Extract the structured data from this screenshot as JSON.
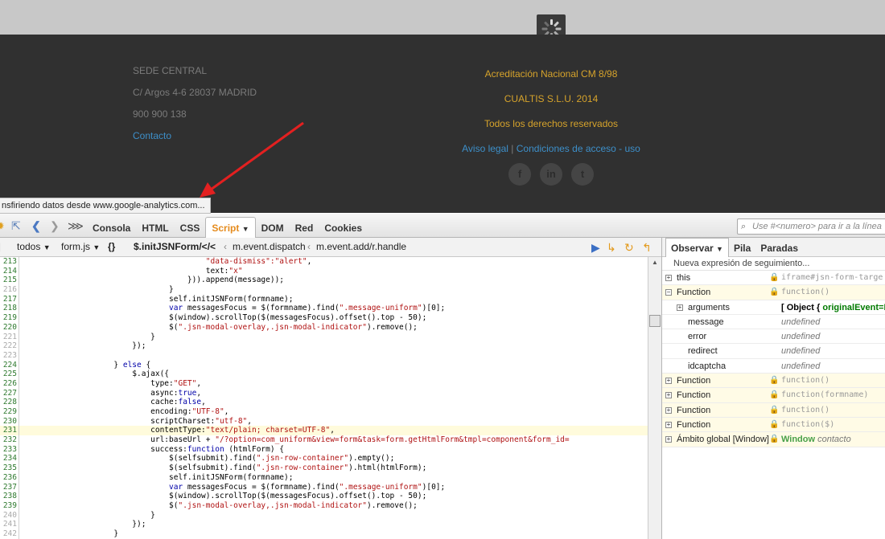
{
  "footer": {
    "left": [
      "SEDE CENTRAL",
      "C/ Argos 4-6 28037 MADRID",
      "900 900 138"
    ],
    "contact_link": "Contacto",
    "right": [
      "Acreditación Nacional CM 8/98",
      "CUALTIS S.L.U. 2014",
      "Todos los derechos reservados"
    ],
    "legal_link": "Aviso legal",
    "legal_sep": "|",
    "terms_link": "Condiciones de acceso - uso",
    "social_glyphs": [
      "f",
      "in",
      "t"
    ]
  },
  "status_text": "nsfiriendo datos desde www.google-analytics.com...",
  "firebug": {
    "tabs": [
      "Consola",
      "HTML",
      "CSS",
      "Script",
      "DOM",
      "Red",
      "Cookies"
    ],
    "active_tab": "Script",
    "search_placeholder": "Use #<numero> para ir a la línea",
    "subbar": {
      "filter": "todos",
      "file": "form.js",
      "pretty": "{}",
      "stack": [
        "$.initJSNForm/</<",
        "m.event.dispatch",
        "m.event.add/r.handle"
      ]
    },
    "side_tabs": [
      "Observar",
      "Pila",
      "Paradas"
    ],
    "watch_new": "Nueva expresión de seguimiento...",
    "watch": [
      {
        "name": "this",
        "value": "iframe#jsn-form-targe",
        "toggle": "+",
        "fn": false,
        "lock": true,
        "indent": 0,
        "kind": "code"
      },
      {
        "name": "Function",
        "value": "function()",
        "toggle": "−",
        "fn": true,
        "lock": true,
        "indent": 0,
        "kind": "code"
      },
      {
        "name": "arguments",
        "value": "[ Object {",
        "value2": "originalEvent=E",
        "toggle": "+",
        "fn": false,
        "lock": false,
        "indent": 1,
        "kind": "obj"
      },
      {
        "name": "message",
        "value": "undefined",
        "toggle": "",
        "fn": false,
        "lock": false,
        "indent": 1,
        "kind": "undef"
      },
      {
        "name": "error",
        "value": "undefined",
        "toggle": "",
        "fn": false,
        "lock": false,
        "indent": 1,
        "kind": "undef"
      },
      {
        "name": "redirect",
        "value": "undefined",
        "toggle": "",
        "fn": false,
        "lock": false,
        "indent": 1,
        "kind": "undef"
      },
      {
        "name": "idcaptcha",
        "value": "undefined",
        "toggle": "",
        "fn": false,
        "lock": false,
        "indent": 1,
        "kind": "undef"
      },
      {
        "name": "Function",
        "value": "function()",
        "toggle": "+",
        "fn": true,
        "lock": true,
        "indent": 0,
        "kind": "code"
      },
      {
        "name": "Function",
        "value": "function(formname)",
        "toggle": "+",
        "fn": true,
        "lock": true,
        "indent": 0,
        "kind": "code"
      },
      {
        "name": "Function",
        "value": "function()",
        "toggle": "+",
        "fn": true,
        "lock": true,
        "indent": 0,
        "kind": "code"
      },
      {
        "name": "Function",
        "value": "function($)",
        "toggle": "+",
        "fn": true,
        "lock": true,
        "indent": 0,
        "kind": "code"
      },
      {
        "name": "Ámbito global [Window]",
        "value": "Window",
        "value2": "contacto",
        "toggle": "+",
        "fn": true,
        "lock": true,
        "indent": 0,
        "kind": "win"
      }
    ],
    "highlight_line": "231",
    "code_lines": [
      {
        "n": "213",
        "t": "                                        <s>\"data-dismiss\":\"alert\"</s>,"
      },
      {
        "n": "214",
        "t": "                                        text:<s>\"x\"</s>"
      },
      {
        "n": "215",
        "t": "                                    })).append(message));"
      },
      {
        "n": "216",
        "t": "                                }"
      },
      {
        "n": "217",
        "t": "                                self.initJSNForm(formname);"
      },
      {
        "n": "218",
        "t": "                                <k>var</k> messagesFocus = $(formname).find(<s>\".message-uniform\"</s>)[0];"
      },
      {
        "n": "219",
        "t": "                                $(window).scrollTop($(messagesFocus).offset().top - 50);"
      },
      {
        "n": "220",
        "t": "                                $(<s>\".jsn-modal-overlay,.jsn-modal-indicator\"</s>).remove();"
      },
      {
        "n": "221",
        "t": "                            }"
      },
      {
        "n": "222",
        "t": "                        });"
      },
      {
        "n": "223",
        "t": ""
      },
      {
        "n": "224",
        "t": "                    } <k>else</k> {"
      },
      {
        "n": "225",
        "t": "                        $.ajax({"
      },
      {
        "n": "226",
        "t": "                            type:<s>\"GET\"</s>,"
      },
      {
        "n": "227",
        "t": "                            async:<k>true</k>,"
      },
      {
        "n": "228",
        "t": "                            cache:<k>false</k>,"
      },
      {
        "n": "229",
        "t": "                            encoding:<s>\"UTF-8\"</s>,"
      },
      {
        "n": "230",
        "t": "                            scriptCharset:<s>\"utf-8\"</s>,"
      },
      {
        "n": "231",
        "t": "                            contentType:<s>\"text/plain; charset=UTF-8\"</s>,"
      },
      {
        "n": "232",
        "t": "                            url:baseUrl + <s>\"/?option=com_uniform&view=form&task=form.getHtmlForm&tmpl=component&form_id=</s>"
      },
      {
        "n": "233",
        "t": "                            success:<k>function</k> (htmlForm) {"
      },
      {
        "n": "234",
        "t": "                                $(selfsubmit).find(<s>\".jsn-row-container\"</s>).empty();"
      },
      {
        "n": "235",
        "t": "                                $(selfsubmit).find(<s>\".jsn-row-container\"</s>).html(htmlForm);"
      },
      {
        "n": "236",
        "t": "                                self.initJSNForm(formname);"
      },
      {
        "n": "237",
        "t": "                                <k>var</k> messagesFocus = $(formname).find(<s>\".message-uniform\"</s>)[0];"
      },
      {
        "n": "238",
        "t": "                                $(window).scrollTop($(messagesFocus).offset().top - 50);"
      },
      {
        "n": "239",
        "t": "                                $(<s>\".jsn-modal-overlay,.jsn-modal-indicator\"</s>).remove();"
      },
      {
        "n": "240",
        "t": "                            }"
      },
      {
        "n": "241",
        "t": "                        });"
      },
      {
        "n": "242",
        "t": "                    }"
      }
    ],
    "dim_lines": [
      "216",
      "221",
      "222",
      "223",
      "240",
      "241",
      "242"
    ]
  }
}
